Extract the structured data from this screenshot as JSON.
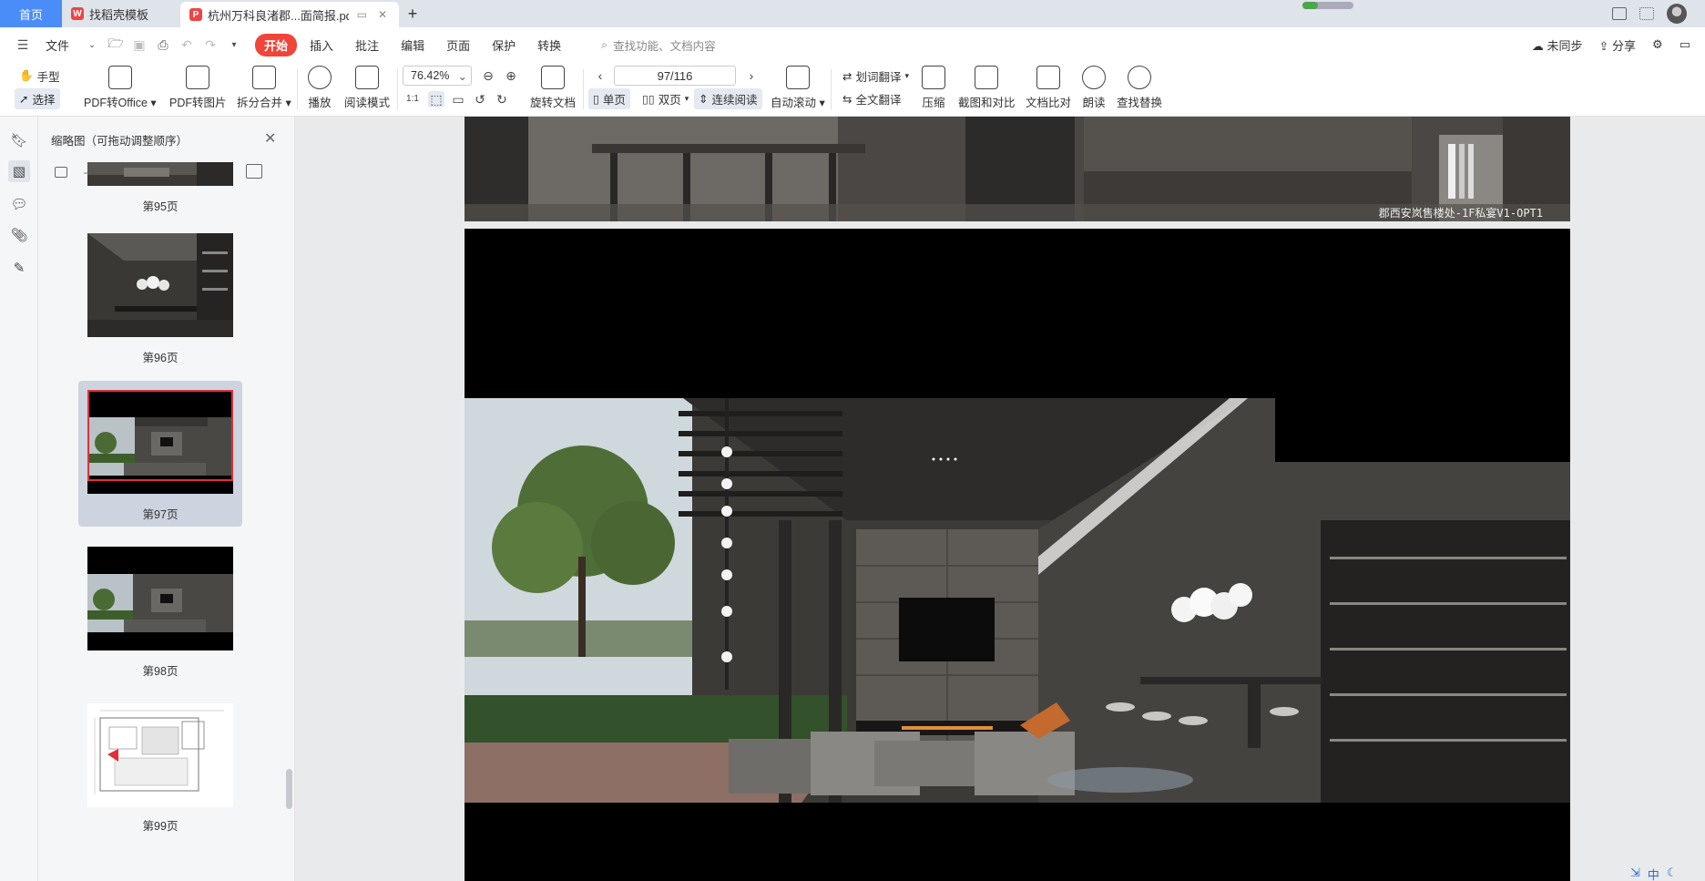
{
  "tabs": {
    "home": "首页",
    "templates": "找稻壳模板",
    "document": "杭州万科良渚郡...面简报.pdf",
    "add": "+"
  },
  "menu": {
    "file": "文件",
    "items": [
      "开始",
      "插入",
      "批注",
      "编辑",
      "页面",
      "保护",
      "转换"
    ],
    "search_placeholder": "查找功能、文档内容",
    "sync": "未同步",
    "share": "分享"
  },
  "ribbon": {
    "hand": "手型",
    "select": "选择",
    "pdf_to_office": "PDF转Office",
    "pdf_to_image": "PDF转图片",
    "split_merge": "拆分合并",
    "play": "播放",
    "reading_mode": "阅读模式",
    "zoom": "76.42%",
    "rotate_doc": "旋转文档",
    "page_indicator": "97/116",
    "single_page": "单页",
    "double_page": "双页",
    "continuous": "连续阅读",
    "auto_scroll": "自动滚动",
    "word_translate": "划词翻译",
    "full_translate": "全文翻译",
    "compress": "压缩",
    "screenshot_compare": "截图和对比",
    "doc_compare": "文档比对",
    "read_aloud": "朗读",
    "find_replace": "查找替换",
    "actual_size": "1:1"
  },
  "thumbnail_panel": {
    "title": "缩略图（可拖动调整顺序）",
    "pages": [
      {
        "label": "第95页"
      },
      {
        "label": "第96页"
      },
      {
        "label": "第97页",
        "selected": true
      },
      {
        "label": "第98页"
      },
      {
        "label": "第99页"
      }
    ]
  },
  "document": {
    "page_caption": "郡西安岚售楼处-1F私宴V1-OPT1"
  },
  "status": {
    "ime": "中"
  },
  "colors": {
    "accent": "#4a8df8",
    "active_menu": "#f0453a",
    "selected_thumb": "#cdd4df"
  }
}
